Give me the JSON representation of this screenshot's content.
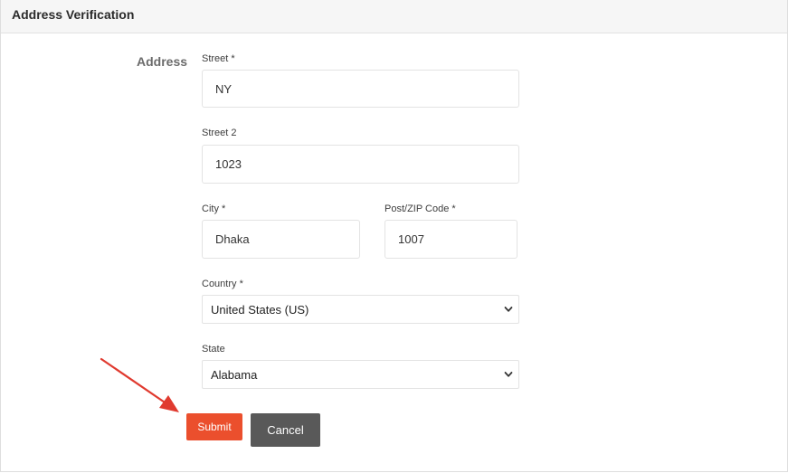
{
  "header": {
    "title": "Address Verification"
  },
  "form": {
    "section_label": "Address",
    "street": {
      "label": "Street *",
      "value": "NY"
    },
    "street2": {
      "label": "Street 2",
      "value": "1023"
    },
    "city": {
      "label": "City *",
      "value": "Dhaka"
    },
    "zip": {
      "label": "Post/ZIP Code *",
      "value": "1007"
    },
    "country": {
      "label": "Country *",
      "selected": "United States (US)"
    },
    "state": {
      "label": "State",
      "selected": "Alabama"
    }
  },
  "actions": {
    "submit_label": "Submit",
    "cancel_label": "Cancel"
  },
  "colors": {
    "submit_bg": "#eb4f2d",
    "cancel_bg": "#595959",
    "annotation_arrow": "#e03a2f"
  },
  "icons": {
    "select_chevron": "chevron-down-icon",
    "annotation": "red-arrow-annotation"
  }
}
